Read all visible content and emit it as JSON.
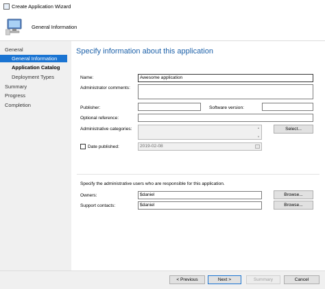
{
  "window": {
    "title": "Create Application Wizard"
  },
  "header": {
    "title": "General Information"
  },
  "sidebar": {
    "items": [
      {
        "label": "General"
      },
      {
        "label": "General Information"
      },
      {
        "label": "Application Catalog"
      },
      {
        "label": "Deployment Types"
      },
      {
        "label": "Summary"
      },
      {
        "label": "Progress"
      },
      {
        "label": "Completion"
      }
    ]
  },
  "main": {
    "heading": "Specify information about this application",
    "fields": {
      "name": {
        "label": "Name:",
        "value": "Awesome application"
      },
      "admin_comments": {
        "label": "Administrator comments:",
        "value": ""
      },
      "publisher": {
        "label": "Publisher:",
        "value": ""
      },
      "software_version": {
        "label": "Software version:",
        "value": ""
      },
      "optional_reference": {
        "label": "Optional reference:",
        "value": ""
      },
      "admin_categories": {
        "label": "Administrative categories:",
        "value": ""
      },
      "select_button": "Select...",
      "date_published": {
        "label": "Date published:",
        "value": "2019-02-08",
        "checked": false
      }
    },
    "admin_users_note": "Specify the administrative users who are responsible for this application.",
    "owners": {
      "label": "Owners:",
      "value": "$daniel",
      "browse": "Browse..."
    },
    "support_contacts": {
      "label": "Support contacts:",
      "value": "$daniel",
      "browse": "Browse..."
    }
  },
  "footer": {
    "previous": "< Previous",
    "next": "Next >",
    "summary": "Summary",
    "cancel": "Cancel"
  },
  "colors": {
    "accent": "#1a74d2",
    "heading": "#1a5fa8",
    "sidebar_bg": "#f0f0f0"
  }
}
